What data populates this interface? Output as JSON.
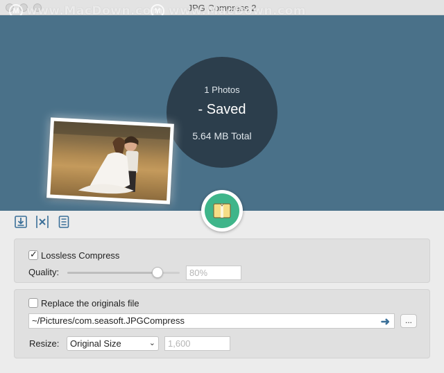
{
  "window": {
    "title": "JPG Compress 2"
  },
  "watermark": {
    "text_1": "www.MacDown.com",
    "text_2": "www.MacDown.com",
    "logo_letter": "M"
  },
  "stats": {
    "photos": "1 Photos",
    "saved": "- Saved",
    "total": "5.64 MB Total"
  },
  "toolbar": {
    "items": [
      "import-icon",
      "remove-icon",
      "list-icon"
    ]
  },
  "compress": {
    "lossless_checked": true,
    "lossless_label": "Lossless Compress",
    "quality_label": "Quality:",
    "quality_value": "80%",
    "quality_level": 0.8
  },
  "output": {
    "replace_checked": false,
    "replace_label": "Replace the originals file",
    "path": "~/Pictures/com.seasoft.JPGCompress",
    "more_label": "...",
    "resize_label": "Resize:",
    "resize_option": "Original Size",
    "resize_value": "1,600"
  },
  "colors": {
    "hero": "#4a7189",
    "circle": "#2c3e4c",
    "accent_green": "#3fb58a",
    "icon_blue": "#3a6f98"
  }
}
